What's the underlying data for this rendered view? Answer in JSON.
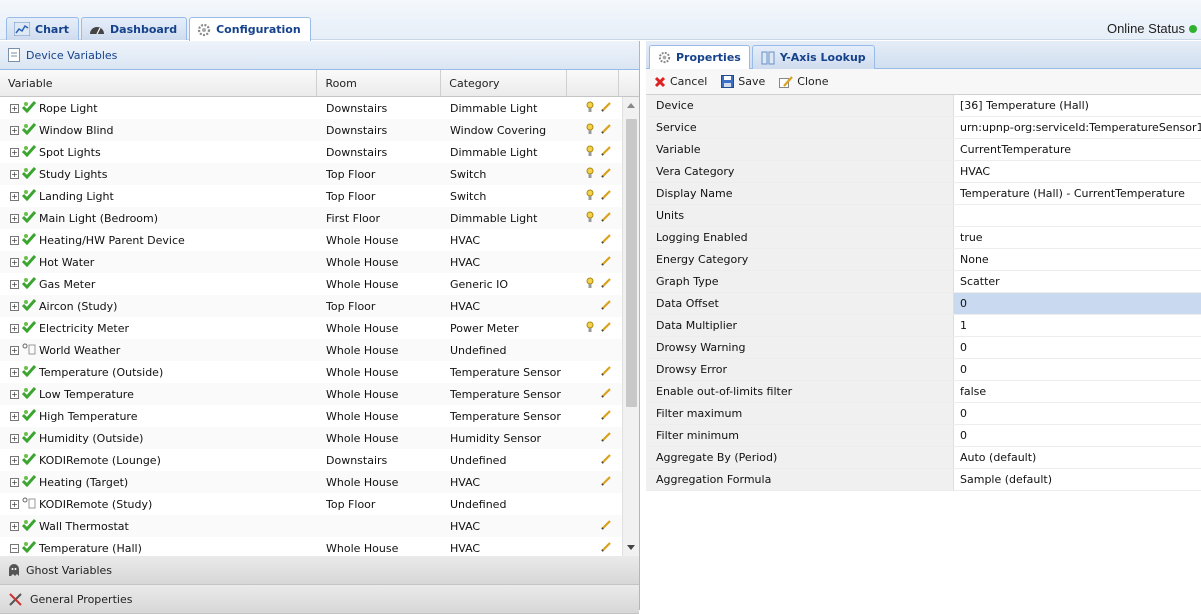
{
  "top_tabs": [
    {
      "label": "Chart",
      "icon": "chart-icon"
    },
    {
      "label": "Dashboard",
      "icon": "dashboard-icon"
    },
    {
      "label": "Configuration",
      "icon": "gear-icon"
    }
  ],
  "online_status": {
    "label": "Online Status",
    "color": "#2fb12f"
  },
  "left_panel": {
    "device_variables_title": "Device Variables",
    "columns": [
      "Variable",
      "Room",
      "Category"
    ],
    "rows": [
      {
        "variable": "Rope Light",
        "room": "Downstairs",
        "category": "Dimmable Light",
        "expand": "+",
        "icon": "device-icon",
        "bulb": true,
        "edit": true
      },
      {
        "variable": "Window Blind",
        "room": "Downstairs",
        "category": "Window Covering",
        "expand": "+",
        "icon": "device-icon",
        "bulb": true,
        "edit": true
      },
      {
        "variable": "Spot Lights",
        "room": "Downstairs",
        "category": "Dimmable Light",
        "expand": "+",
        "icon": "device-icon",
        "bulb": true,
        "edit": true
      },
      {
        "variable": "Study Lights",
        "room": "Top Floor",
        "category": "Switch",
        "expand": "+",
        "icon": "device-icon",
        "bulb": true,
        "edit": true
      },
      {
        "variable": "Landing Light",
        "room": "Top Floor",
        "category": "Switch",
        "expand": "+",
        "icon": "device-icon",
        "bulb": true,
        "edit": true
      },
      {
        "variable": "Main Light (Bedroom)",
        "room": "First Floor",
        "category": "Dimmable Light",
        "expand": "+",
        "icon": "device-icon",
        "bulb": true,
        "edit": true
      },
      {
        "variable": "Heating/HW Parent Device",
        "room": "Whole House",
        "category": "HVAC",
        "expand": "+",
        "icon": "device-icon",
        "bulb": false,
        "edit": true
      },
      {
        "variable": "Hot Water",
        "room": "Whole House",
        "category": "HVAC",
        "expand": "+",
        "icon": "device-icon",
        "bulb": false,
        "edit": true
      },
      {
        "variable": "Gas Meter",
        "room": "Whole House",
        "category": "Generic IO",
        "expand": "+",
        "icon": "device-icon",
        "bulb": true,
        "edit": true
      },
      {
        "variable": "Aircon (Study)",
        "room": "Top Floor",
        "category": "HVAC",
        "expand": "+",
        "icon": "device-icon",
        "bulb": false,
        "edit": true
      },
      {
        "variable": "Electricity Meter",
        "room": "Whole House",
        "category": "Power Meter",
        "expand": "+",
        "icon": "device-icon",
        "bulb": true,
        "edit": true
      },
      {
        "variable": "World Weather",
        "room": "Whole House",
        "category": "Undefined",
        "expand": "+",
        "icon": "plugin-icon",
        "bulb": false,
        "edit": false
      },
      {
        "variable": "Temperature (Outside)",
        "room": "Whole House",
        "category": "Temperature Sensor",
        "expand": "+",
        "icon": "device-icon",
        "bulb": false,
        "edit": true
      },
      {
        "variable": "Low Temperature",
        "room": "Whole House",
        "category": "Temperature Sensor",
        "expand": "+",
        "icon": "device-icon",
        "bulb": false,
        "edit": true
      },
      {
        "variable": "High Temperature",
        "room": "Whole House",
        "category": "Temperature Sensor",
        "expand": "+",
        "icon": "device-icon",
        "bulb": false,
        "edit": true
      },
      {
        "variable": "Humidity (Outside)",
        "room": "Whole House",
        "category": "Humidity Sensor",
        "expand": "+",
        "icon": "device-icon",
        "bulb": false,
        "edit": true
      },
      {
        "variable": "KODIRemote (Lounge)",
        "room": "Downstairs",
        "category": "Undefined",
        "expand": "+",
        "icon": "device-icon",
        "bulb": false,
        "edit": true
      },
      {
        "variable": "Heating (Target)",
        "room": "Whole House",
        "category": "HVAC",
        "expand": "+",
        "icon": "device-icon",
        "bulb": false,
        "edit": true
      },
      {
        "variable": "KODIRemote (Study)",
        "room": "Top Floor",
        "category": "Undefined",
        "expand": "+",
        "icon": "plugin-icon",
        "bulb": false,
        "edit": false
      },
      {
        "variable": "Wall Thermostat",
        "room": "",
        "category": "HVAC",
        "expand": "+",
        "icon": "device-icon",
        "bulb": false,
        "edit": true
      },
      {
        "variable": "Temperature (Hall)",
        "room": "Whole House",
        "category": "HVAC",
        "expand": "−",
        "icon": "device-icon",
        "bulb": false,
        "edit": true
      }
    ],
    "ghost_variables_title": "Ghost Variables",
    "general_properties_title": "General Properties"
  },
  "right_panel": {
    "tabs": [
      {
        "label": "Properties",
        "icon": "gear-icon"
      },
      {
        "label": "Y-Axis Lookup",
        "icon": "axis-icon"
      }
    ],
    "toolbar": {
      "cancel": "Cancel",
      "save": "Save",
      "clone": "Clone"
    },
    "properties": [
      {
        "name": "Device",
        "value": "[36] Temperature (Hall)"
      },
      {
        "name": "Service",
        "value": "urn:upnp-org:serviceId:TemperatureSensor1"
      },
      {
        "name": "Variable",
        "value": "CurrentTemperature"
      },
      {
        "name": "Vera Category",
        "value": "HVAC"
      },
      {
        "name": "Display Name",
        "value": "Temperature (Hall) - CurrentTemperature"
      },
      {
        "name": "Units",
        "value": ""
      },
      {
        "name": "Logging Enabled",
        "value": "true"
      },
      {
        "name": "Energy Category",
        "value": "None"
      },
      {
        "name": "Graph Type",
        "value": "Scatter"
      },
      {
        "name": "Data Offset",
        "value": "0",
        "selected": true
      },
      {
        "name": "Data Multiplier",
        "value": "1"
      },
      {
        "name": "Drowsy Warning",
        "value": "0"
      },
      {
        "name": "Drowsy Error",
        "value": "0"
      },
      {
        "name": "Enable out-of-limits filter",
        "value": "false"
      },
      {
        "name": "Filter maximum",
        "value": "0"
      },
      {
        "name": "Filter minimum",
        "value": "0"
      },
      {
        "name": "Aggregate By (Period)",
        "value": "Auto (default)"
      },
      {
        "name": "Aggregation Formula",
        "value": "Sample (default)"
      }
    ]
  }
}
